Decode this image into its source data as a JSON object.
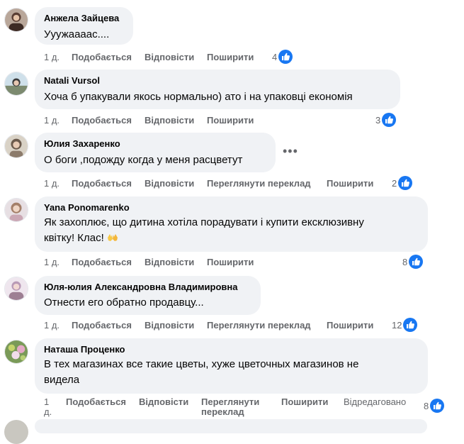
{
  "colors": {
    "bubble": "#f0f2f5",
    "meta_text": "#65676b",
    "like_blue": "#1877f2"
  },
  "labels": {
    "like": "Подобається",
    "reply": "Відповісти",
    "share": "Поширити",
    "translate": "Переглянути переклад",
    "translate_line1": "Переглянути",
    "translate_line2": "переклад",
    "edited": "Відредаговано"
  },
  "comments": [
    {
      "author": "Анжела Зайцева",
      "text": "Ууужаааас....",
      "time": "1 д.",
      "likes": "4",
      "avatar_icon": "user-avatar-icon"
    },
    {
      "author": "Natali Vursol",
      "text": "Хоча б упакували якось нормально) ато і на упаковці економія",
      "time": "1 д.",
      "likes": "3",
      "avatar_icon": "user-avatar-icon"
    },
    {
      "author": "Юлия Захаренко",
      "text": "О боги ,подожду когда у меня расцветут",
      "time": "1 д.",
      "likes": "2",
      "avatar_icon": "user-avatar-icon"
    },
    {
      "author": "Yana Ponomarenko",
      "text_line1": "Як захоплює, що дитина хотіла порадувати і купити ексклюзивну",
      "text_line2": "квітку! Клас!",
      "time": "1 д.",
      "likes": "8",
      "avatar_icon": "user-avatar-icon",
      "emoji_icon": "raising-hands-emoji-icon"
    },
    {
      "author": "Юля-юлия Александровна Владимировна",
      "text": "Отнести его обратно продавцу...",
      "time": "1 д.",
      "likes": "12",
      "avatar_icon": "user-avatar-icon"
    },
    {
      "author": "Наташа Проценко",
      "text_line1": "В тех магазинах все такие цветы, хуже цветочных магазинов не",
      "text_line2": "видела",
      "time_line1": "1",
      "time_line2": "д.",
      "likes": "8",
      "avatar_icon": "user-avatar-icon"
    }
  ],
  "icons": {
    "like": "thumbs-up-icon",
    "more": "more-options-icon"
  }
}
